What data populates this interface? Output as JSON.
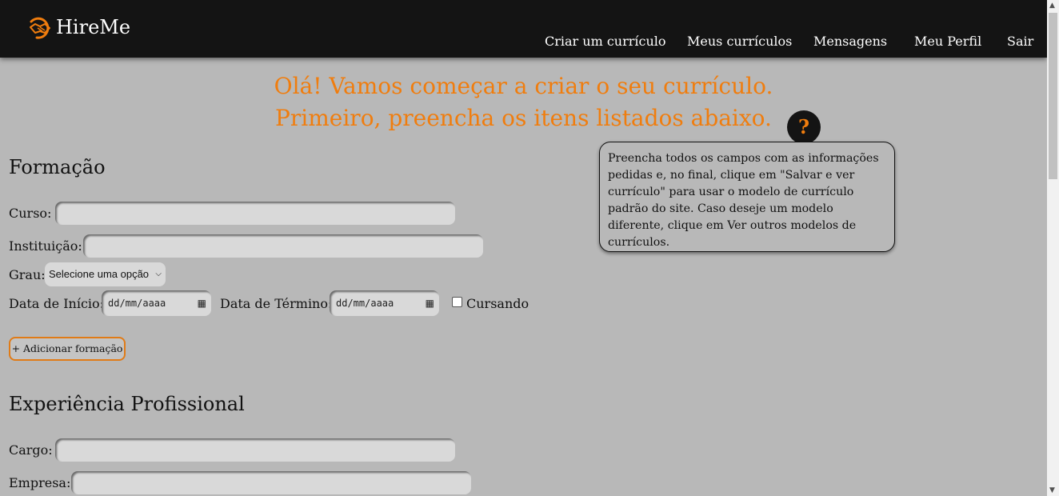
{
  "brand": {
    "name": "HireMe",
    "icon": "handshake-icon",
    "accent_color": "#f07d0e"
  },
  "nav": {
    "create": "Criar um currículo",
    "my_resumes": "Meus currículos",
    "messages": "Mensagens",
    "profile": "Meu Perfil",
    "logout": "Sair"
  },
  "headline": {
    "line1": "Olá! Vamos começar a criar o seu currículo.",
    "line2": "Primeiro, preencha os itens listados abaixo."
  },
  "help": {
    "button": "?",
    "tooltip": "Preencha todos os campos com as informações pedidas e, no final, clique em \"Salvar e ver currículo\" para usar o modelo de currículo padrão do site. Caso deseje um modelo diferente, clique em Ver outros modelos de currículos."
  },
  "education": {
    "title": "Formação",
    "course_label": "Curso:",
    "course_value": "",
    "institution_label": "Instituição:",
    "institution_value": "",
    "degree_label": "Grau:",
    "degree_selected": "Selecione uma opção",
    "start_label": "Data de Início:",
    "start_placeholder": "dd/mm/aaaa",
    "end_label": "Data de Término:",
    "end_placeholder": "dd/mm/aaaa",
    "ongoing_label": "Cursando",
    "ongoing_checked": false,
    "add_button": "+ Adicionar formação"
  },
  "experience": {
    "title": "Experiência Profissional",
    "role_label": "Cargo:",
    "role_value": "",
    "company_label": "Empresa:",
    "company_value": ""
  }
}
